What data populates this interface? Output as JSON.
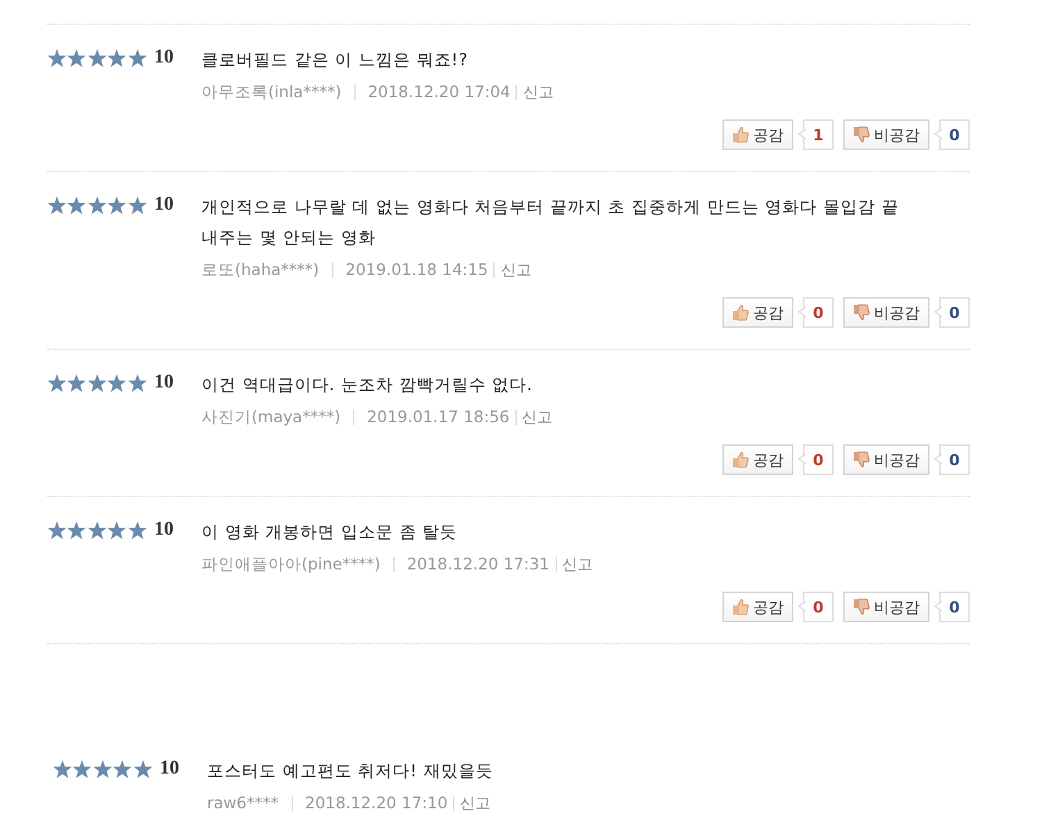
{
  "reviews": [
    {
      "stars": 5,
      "score": "10",
      "text": "클로버필드 같은 이 느낌은 뭐죠!?",
      "author": "아무조록(inla****)",
      "date": "2018.12.20 17:04",
      "report": "신고",
      "like_label": "공감",
      "like_count": "1",
      "dislike_label": "비공감",
      "dislike_count": "0"
    },
    {
      "stars": 5,
      "score": "10",
      "text": "개인적으로 나무랄 데 없는 영화다 처음부터 끝까지 초 집중하게 만드는 영화다 몰입감 끝내주는 몇 안되는 영화",
      "author": "로또(haha****)",
      "date": "2019.01.18 14:15",
      "report": "신고",
      "like_label": "공감",
      "like_count": "0",
      "dislike_label": "비공감",
      "dislike_count": "0"
    },
    {
      "stars": 5,
      "score": "10",
      "text": "이건 역대급이다. 눈조차 깜빡거릴수 없다.",
      "author": "사진기(maya****)",
      "date": "2019.01.17 18:56",
      "report": "신고",
      "like_label": "공감",
      "like_count": "0",
      "dislike_label": "비공감",
      "dislike_count": "0"
    },
    {
      "stars": 5,
      "score": "10",
      "text": "이 영화 개봉하면 입소문 좀 탈듯",
      "author": "파인애플아아(pine****)",
      "date": "2018.12.20 17:31",
      "report": "신고",
      "like_label": "공감",
      "like_count": "0",
      "dislike_label": "비공감",
      "dislike_count": "0"
    }
  ],
  "next_reviews": [
    {
      "stars": 5,
      "score": "10",
      "text": "포스터도 예고편도 취저다! 재밌을듯",
      "author": "raw6****",
      "date": "2018.12.20 17:10",
      "report": "신고"
    }
  ]
}
